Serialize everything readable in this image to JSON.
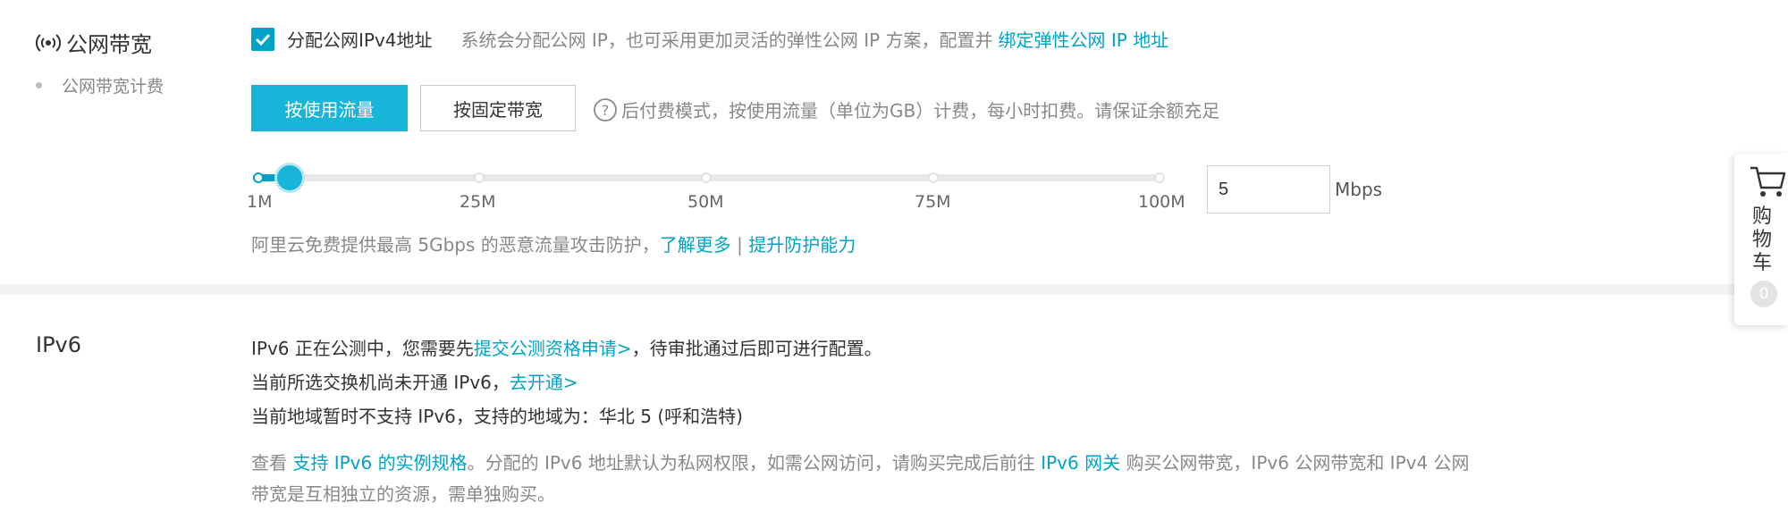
{
  "public_bandwidth": {
    "title": "公网带宽",
    "sub_item": "公网带宽计费",
    "assign_ipv4_label": "分配公网IPv4地址",
    "assign_ipv4_checked": true,
    "assign_ipv4_hint": "系统会分配公网 IP，也可采用更加灵活的弹性公网 IP 方案，配置并",
    "bind_eip_link": "绑定弹性公网 IP 地址",
    "billing_options": [
      "按使用流量",
      "按固定带宽"
    ],
    "billing_selected": "按使用流量",
    "billing_hint": "后付费模式，按使用流量（单位为GB）计费，每小时扣费。请保证余额充足",
    "slider": {
      "ticks": [
        "1M",
        "25M",
        "50M",
        "75M",
        "100M"
      ],
      "min": 1,
      "max": 100,
      "value": 5
    },
    "bandwidth_value": "5",
    "bandwidth_unit": "Mbps",
    "ddos_text": "阿里云免费提供最高 5Gbps 的恶意流量攻击防护，",
    "learn_more_link": "了解更多",
    "separator": "|",
    "upgrade_link": "提升防护能力"
  },
  "ipv6": {
    "title": "IPv6",
    "line1_prefix": "IPv6 正在公测中，您需要先",
    "line1_link": "提交公测资格申请>",
    "line1_suffix": "，待审批通过后即可进行配置。",
    "line2_prefix": "当前所选交换机尚未开通 IPv6，",
    "line2_link": "去开通>",
    "line3": "当前地域暂时不支持 IPv6，支持的地域为：华北 5 (呼和浩特)",
    "note_prefix": "查看",
    "note_link1": "支持 IPv6 的实例规格",
    "note_mid": "。分配的 IPv6 地址默认为私网权限，如需公网访问，请购买完成后前往",
    "note_link2": "IPv6 网关",
    "note_suffix_line1": "购买公网带宽，IPv6 公网带宽和 IPv4 公网",
    "note_line2": "带宽是互相独立的资源，需单独购买。"
  },
  "cart": {
    "label": "购物车",
    "count": "0"
  },
  "colors": {
    "accent": "#00a3c7",
    "primary_button": "#17b6d9"
  }
}
